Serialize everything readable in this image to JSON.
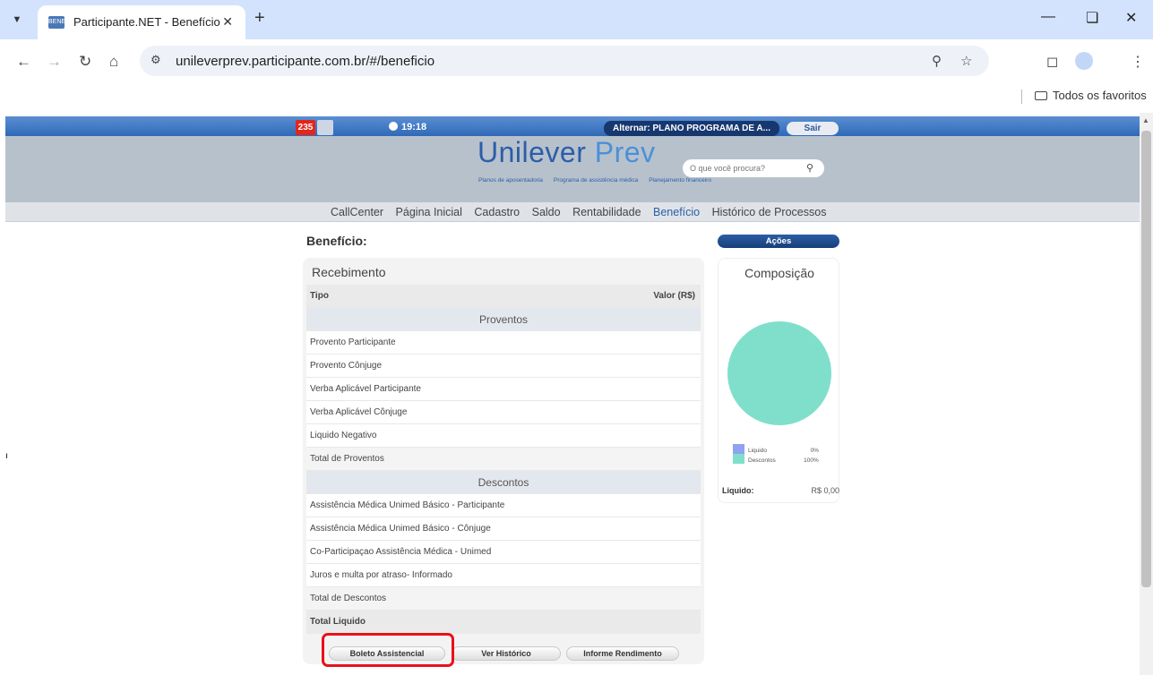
{
  "browser": {
    "tab_title": "Participante.NET - Benefício",
    "favicon_text": "BENE",
    "url": "unileverprev.participante.com.br/#/beneficio",
    "bookmarks_folder": "Todos os favoritos"
  },
  "topbar": {
    "badge": "235",
    "time": "19:18",
    "alternar": "Alternar: PLANO PROGRAMA DE A...",
    "sair": "Sair"
  },
  "logo": {
    "part1": "Unilever",
    "part2": "Prev",
    "tag1": "Planos de aposentadoria",
    "tag2": "Programa de assistência médica",
    "tag3": "Planejamento financeiro"
  },
  "search": {
    "placeholder": "O que você procura?"
  },
  "menu": [
    "CallCenter",
    "Página Inicial",
    "Cadastro",
    "Saldo",
    "Rentabilidade",
    "Benefício",
    "Histórico de Processos"
  ],
  "page_title": "Benefício:",
  "acoes": "Ações",
  "recebimento": {
    "title": "Recebimento",
    "col_tipo": "Tipo",
    "col_valor": "Valor (R$)",
    "proventos_title": "Proventos",
    "proventos": [
      "Provento Participante",
      "Provento Cônjuge",
      "Verba Aplicável Participante",
      "Verba Aplicável Cônjuge",
      "Liquido Negativo",
      "Total de Proventos"
    ],
    "descontos_title": "Descontos",
    "descontos": [
      "Assistência Médica Unimed Básico - Participante",
      "Assistência Médica Unimed Básico - Cônjuge",
      "Co-Participaçao Assistência Médica - Unimed",
      "Juros e multa por atraso- Informado",
      "Total de Descontos"
    ],
    "total_liquido": "Total Liquido"
  },
  "buttons": {
    "boleto": "Boleto Assistencial",
    "historico": "Ver Histórico",
    "informe": "Informe Rendimento"
  },
  "composicao": {
    "title": "Composição",
    "legend": [
      {
        "label": "Liquido",
        "pct": "0%",
        "color": "#8fa3f0"
      },
      {
        "label": "Descontos",
        "pct": "100%",
        "color": "#7fdfcb"
      }
    ],
    "liquido_label": "Liquido:",
    "liquido_value": "R$ 0,00"
  },
  "colors": {
    "topbar": "#2f69b7",
    "pie": "#7fdfcb",
    "highlight": "#e8111b"
  }
}
